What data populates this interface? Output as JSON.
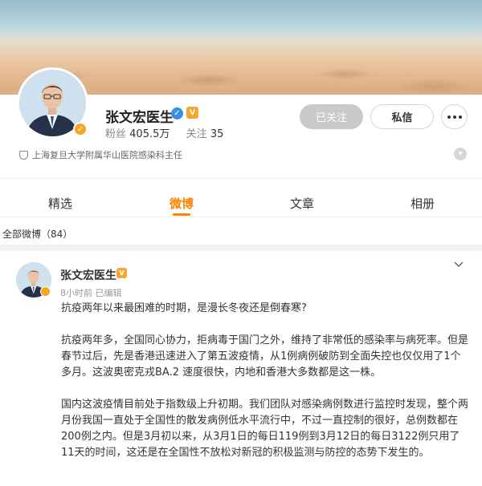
{
  "profile": {
    "name": "张文宏医生",
    "fans_label": "粉丝",
    "fans_count": "405.5万",
    "following_label": "关注",
    "following_count": "35",
    "bio": "上海复旦大学附属华山医院感染科主任",
    "verified_badge": "check-icon",
    "vip_badge": "V"
  },
  "actions": {
    "followed_label": "已关注",
    "message_label": "私信",
    "more_icon": "more-dots-icon"
  },
  "tabs": [
    {
      "label": "精选",
      "active": false
    },
    {
      "label": "微博",
      "active": true
    },
    {
      "label": "文章",
      "active": false
    },
    {
      "label": "相册",
      "active": false
    }
  ],
  "feed": {
    "all_posts_label": "全部微博（84）"
  },
  "post": {
    "author": "张文宏医生",
    "time": "8小时前",
    "edited": "已编辑",
    "paragraphs": [
      "抗疫两年以来最困难的时期，是漫长冬夜还是倒春寒?",
      "抗疫两年多，全国同心协力，拒病毒于国门之外，维持了非常低的感染率与病死率。但是春节过后，先是香港迅速进入了第五波疫情，从1例病例破防到全面失控也仅仅用了1个多月。这波奥密克戎BA.2 速度很快，内地和香港大多数都是这一株。",
      "国内这波疫情目前处于指数级上升初期。我们团队对感染病例数进行监控时发现，整个两月份我国一直处于全国性的散发病例低水平流行中，不过一直控制的很好，总例数都在200例之内。但是3月初以来，从3月1日的每日119例到3月12日的每日3122例只用了11天的时间，这还是在全国性不放松对新冠的积极监测与防控的态势下发生的。"
    ]
  },
  "colors": {
    "accent": "#ff8200",
    "followed_bg": "#c9c9c9",
    "verified_blue": "#3a8ee6",
    "vip_gold": "#f3a72e"
  }
}
